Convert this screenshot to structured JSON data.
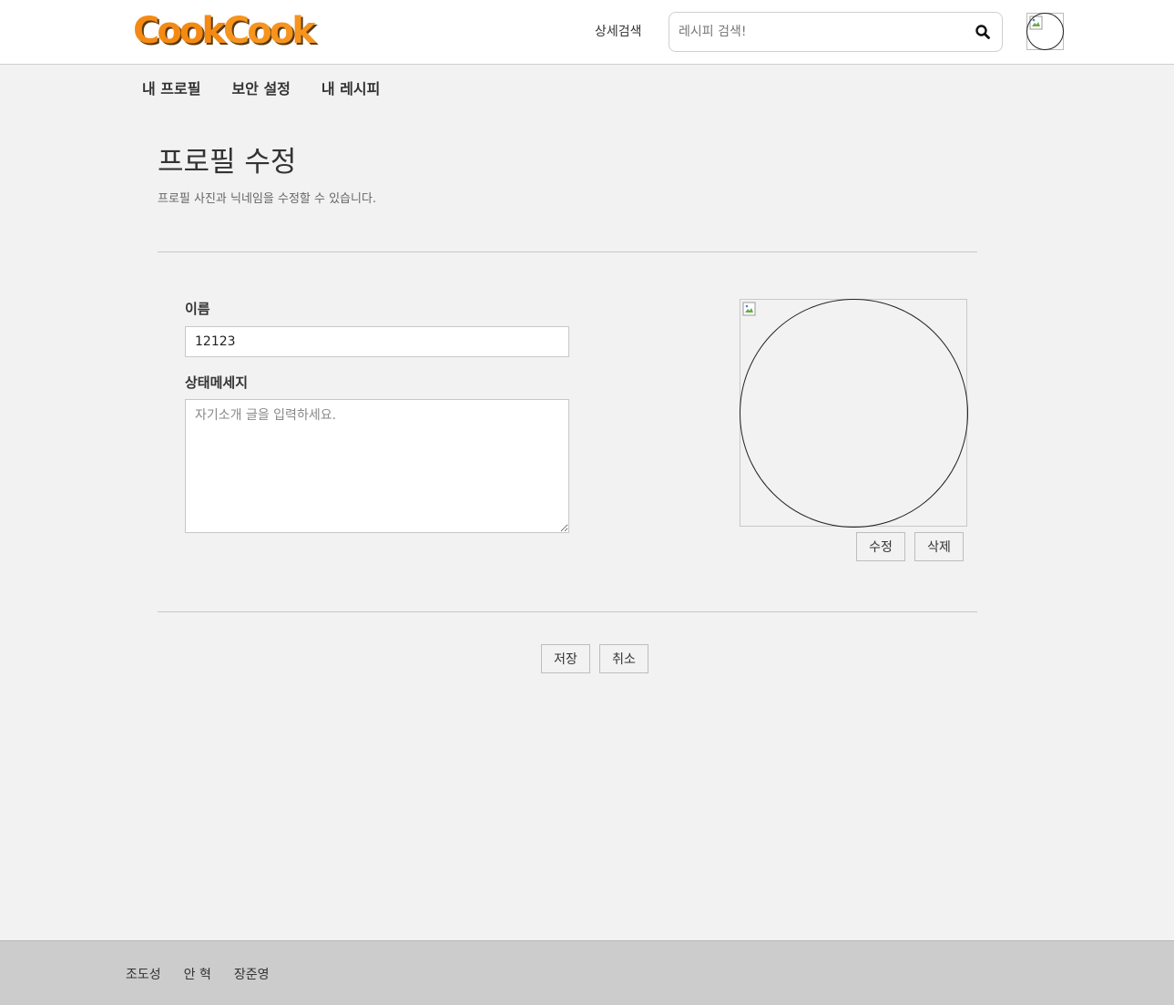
{
  "header": {
    "logo_text": "CookCook",
    "logo_part1": "Cook",
    "logo_part2": "Cook",
    "detail_search_label": "상세검색",
    "search_placeholder": "레시피 검색!",
    "search_icon": "search-icon",
    "avatar_icon": "user-avatar"
  },
  "subnav": {
    "items": [
      {
        "label": "내 프로필"
      },
      {
        "label": "보안 설정"
      },
      {
        "label": "내 레시피"
      }
    ]
  },
  "main": {
    "title": "프로필 수정",
    "description": "프로필 사진과 닉네임을 수정할 수 있습니다.",
    "name_label": "이름",
    "name_value": "12123",
    "status_label": "상태메세지",
    "status_placeholder": "자기소개 글을 입력하세요.",
    "status_value": "",
    "photo_edit_label": "수정",
    "photo_delete_label": "삭제",
    "save_label": "저장",
    "cancel_label": "취소"
  },
  "footer": {
    "names": [
      "조도성",
      "안 혁",
      "장준영"
    ]
  },
  "colors": {
    "brand_orange": "#f58a12",
    "background": "#f2f2f2",
    "footer_bg": "#cccccc"
  }
}
